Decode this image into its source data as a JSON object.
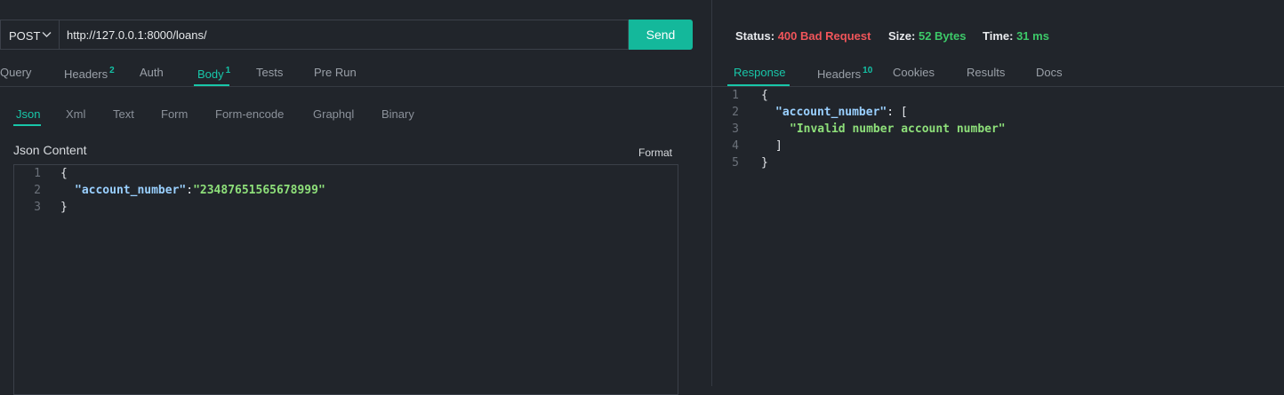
{
  "request": {
    "method": "POST",
    "url": "http://127.0.0.1:8000/loans/",
    "send_label": "Send"
  },
  "request_tabs": [
    {
      "label": "Query"
    },
    {
      "label": "Headers",
      "badge": "2"
    },
    {
      "label": "Auth"
    },
    {
      "label": "Body",
      "badge": "1",
      "active": true
    },
    {
      "label": "Tests"
    },
    {
      "label": "Pre Run"
    }
  ],
  "body_tabs": [
    {
      "label": "Json",
      "active": true
    },
    {
      "label": "Xml"
    },
    {
      "label": "Text"
    },
    {
      "label": "Form"
    },
    {
      "label": "Form-encode"
    },
    {
      "label": "Graphql"
    },
    {
      "label": "Binary"
    }
  ],
  "body": {
    "section_title": "Json Content",
    "format_label": "Format",
    "line_numbers": [
      "1",
      "2",
      "3"
    ],
    "brace_open": "{",
    "key": "\"account_number\"",
    "colon": ":",
    "value": "\"23487651565678999\"",
    "brace_close": "}"
  },
  "response_status": {
    "status_label": "Status:",
    "status_value": "400 Bad Request",
    "size_label": "Size:",
    "size_value": "52 Bytes",
    "time_label": "Time:",
    "time_value": "31 ms"
  },
  "response_tabs": [
    {
      "label": "Response",
      "active": true
    },
    {
      "label": "Headers",
      "badge": "10"
    },
    {
      "label": "Cookies"
    },
    {
      "label": "Results"
    },
    {
      "label": "Docs"
    }
  ],
  "response_body": {
    "line_numbers": [
      "1",
      "2",
      "3",
      "4",
      "5"
    ],
    "brace_open": "{",
    "key": "\"account_number\"",
    "colon_bracket": ": [",
    "message": "\"Invalid number account number\"",
    "bracket_close": "]",
    "brace_close": "}"
  },
  "colors": {
    "accent": "#18c7a9",
    "error": "#f0555a",
    "success": "#3dc969",
    "background": "#21252b"
  }
}
